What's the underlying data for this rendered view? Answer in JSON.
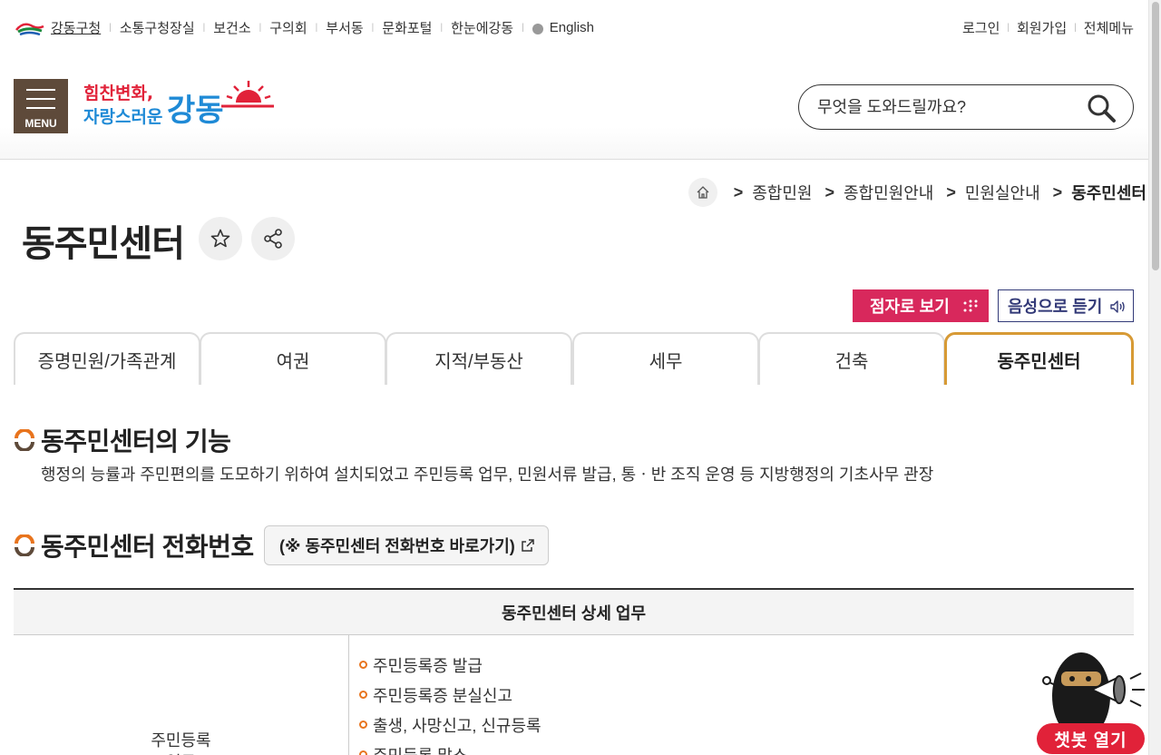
{
  "util_nav": {
    "items": [
      {
        "label": "강동구청"
      },
      {
        "label": "소통구청장실"
      },
      {
        "label": "보건소"
      },
      {
        "label": "구의회"
      },
      {
        "label": "부서동"
      },
      {
        "label": "문화포털"
      },
      {
        "label": "한눈에강동"
      }
    ],
    "english": "English",
    "right": [
      {
        "label": "로그인"
      },
      {
        "label": "회원가입"
      },
      {
        "label": "전체메뉴"
      }
    ]
  },
  "header": {
    "menu_label": "MENU",
    "brand_slogan_1": "힘찬변화,",
    "brand_slogan_2": "자랑스러운",
    "brand_name": "강동",
    "search_placeholder": "무엇을 도와드릴까요?"
  },
  "breadcrumb": {
    "items": [
      {
        "label": "종합민원"
      },
      {
        "label": "종합민원안내"
      },
      {
        "label": "민원실안내"
      }
    ],
    "current": "동주민센터",
    "sep": ">"
  },
  "page": {
    "title": "동주민센터",
    "braille_label": "점자로 보기",
    "voice_label": "음성으로 듣기"
  },
  "tabs": [
    {
      "label": "증명민원/가족관계",
      "active": false
    },
    {
      "label": "여권",
      "active": false
    },
    {
      "label": "지적/부동산",
      "active": false
    },
    {
      "label": "세무",
      "active": false
    },
    {
      "label": "건축",
      "active": false
    },
    {
      "label": "동주민센터",
      "active": true
    }
  ],
  "section1": {
    "heading": "동주민센터의 기능",
    "text": "행정의 능률과 주민편의를 도모하기 위하여 설치되었고 주민등록 업무, 민원서류 발급, 통ㆍ반 조직 운영 등 지방행정의 기초사무 관장"
  },
  "section2": {
    "heading": "동주민센터 전화번호",
    "link_label": "(※ 동주민센터 전화번호 바로가기)"
  },
  "table": {
    "header": "동주민센터 상세 업무",
    "row_category": "주민등록",
    "row_category_2": "업무",
    "items": [
      "주민등록증 발급",
      "주민등록증 분실신고",
      "출생, 사망신고, 신규등록",
      "주민등록 말소"
    ]
  },
  "chatbot": {
    "label": "챗봇 열기"
  },
  "colors": {
    "menu_bg": "#5e4a3a",
    "tab_accent": "#d79a35",
    "braille_bg": "#d8285c",
    "voice_border": "#333a78",
    "bullet": "#e8741d",
    "chat_bg": "#e12239"
  }
}
